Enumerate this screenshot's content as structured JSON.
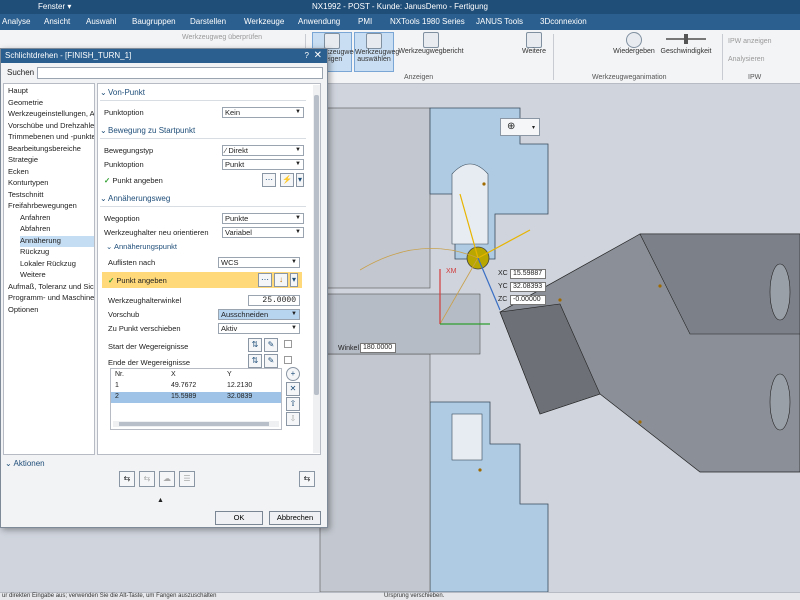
{
  "titlebar": {
    "title": "NX1992 - POST - Kunde: JanusDemo - Fertigung",
    "fenster": "Fenster ▾"
  },
  "menu": [
    "Analyse",
    "Ansicht",
    "Auswahl",
    "Baugruppen",
    "Darstellen",
    "Werkzeuge",
    "Anwendung",
    "PMI",
    "NXTools 1980 Series",
    "JANUS Tools",
    "3Dconnexion"
  ],
  "ribbon": {
    "werkzeugweg_pruefen": "Werkzeugweg überprüfen",
    "btn_werkzeugweg_zeigen": "Werkzeugweg zeigen",
    "btn_werkzeugweg_auswaehlen": "Werkzeugweg auswählen",
    "btn_werkzeugwegbericht": "Werkzeugwegbericht",
    "btn_weitere": "Weitere",
    "btn_wiedergeben": "Wiedergeben",
    "geschwindigkeit": "Geschwindigkeit",
    "ipw_anzeigen": "IPW anzeigen",
    "analysieren": "Analysieren",
    "group_anzeigen": "Anzeigen",
    "group_animation": "Werkzeugweganimation",
    "group_ipw": "IPW"
  },
  "dialog": {
    "title": "Schlichtdrehen - [FINISH_TURN_1]",
    "help": "?",
    "close": "✕",
    "search_label": "Suchen",
    "search_value": "",
    "tree": [
      {
        "label": "Haupt",
        "indent": 0,
        "sel": false
      },
      {
        "label": "Geometrie",
        "indent": 0,
        "sel": false
      },
      {
        "label": "Werkzeugeinstellungen, Ac",
        "indent": 0,
        "sel": false
      },
      {
        "label": "Vorschübe und Drehzahlen",
        "indent": 0,
        "sel": false
      },
      {
        "label": "Trimmebenen und -punkte",
        "indent": 0,
        "sel": false
      },
      {
        "label": "Bearbeitungsbereiche",
        "indent": 0,
        "sel": false
      },
      {
        "label": "Strategie",
        "indent": 0,
        "sel": false
      },
      {
        "label": "Ecken",
        "indent": 0,
        "sel": false
      },
      {
        "label": "Konturtypen",
        "indent": 0,
        "sel": false
      },
      {
        "label": "Testschnitt",
        "indent": 0,
        "sel": false
      },
      {
        "label": "Freifahrbewegungen",
        "indent": 0,
        "sel": false
      },
      {
        "label": "Anfahren",
        "indent": 1,
        "sel": false
      },
      {
        "label": "Abfahren",
        "indent": 1,
        "sel": false
      },
      {
        "label": "Annäherung",
        "indent": 1,
        "sel": true
      },
      {
        "label": "Rückzug",
        "indent": 1,
        "sel": false
      },
      {
        "label": "Lokaler Rückzug",
        "indent": 1,
        "sel": false
      },
      {
        "label": "Weitere",
        "indent": 1,
        "sel": false
      },
      {
        "label": "Aufmaß, Toleranz und Sich",
        "indent": 0,
        "sel": false
      },
      {
        "label": "Programm- und Maschine",
        "indent": 0,
        "sel": false
      },
      {
        "label": "Optionen",
        "indent": 0,
        "sel": false
      }
    ],
    "von_punkt": {
      "header": "Von-Punkt",
      "punktoption_label": "Punktoption",
      "punktoption_value": "Kein"
    },
    "bewegung": {
      "header": "Bewegung zu Startpunkt",
      "bewegungstyp_label": "Bewegungstyp",
      "bewegungstyp_value": "Direkt",
      "punktoption_label": "Punktoption",
      "punktoption_value": "Punkt",
      "punkt_angeben_label": "Punkt angeben"
    },
    "annaeherungsweg": {
      "header": "Annäherungsweg",
      "wegoption_label": "Wegoption",
      "wegoption_value": "Punkte",
      "wzh_label": "Werkzeughalter neu orientieren",
      "wzh_value": "Variabel",
      "sub_header": "Annäherungspunkt",
      "auflisten_label": "Auflisten nach",
      "auflisten_value": "WCS",
      "punkt_angeben_label": "Punkt angeben",
      "winkel_label": "Werkzeughalterwinkel",
      "winkel_value": "25.0000",
      "vorschub_label": "Vorschub",
      "vorschub_value": "Ausschneiden",
      "zu_punkt_label": "Zu Punkt verschieben",
      "zu_punkt_value": "Aktiv",
      "start_label": "Start der Wegereignisse",
      "ende_label": "Ende der Wegereignisse"
    },
    "table": {
      "headers": [
        "Nr.",
        "X",
        "Y"
      ],
      "rows": [
        {
          "nr": "1",
          "x": "49.7672",
          "y": "12.2130",
          "sel": false
        },
        {
          "nr": "2",
          "x": "15.5989",
          "y": "32.0839",
          "sel": true
        }
      ]
    },
    "aktionen": "Aktionen",
    "ok": "OK",
    "abbrechen": "Abbrechen"
  },
  "viewport": {
    "coords": {
      "xc_label": "XC",
      "xc_value": "15.59887",
      "yc_label": "YC",
      "yc_value": "32.08393",
      "zc_label": "ZC",
      "zc_value": "-0.00000"
    },
    "winkel_label": "Winkel",
    "winkel_value": "180.0000",
    "xm_label": "XM"
  },
  "statusbar": {
    "left": "ur direkten Eingabe aus; verwenden Sie die Alt-Taste, um Fangen auszuschalten",
    "right": "Ursprung verschieben."
  },
  "colors": {
    "titlebar": "#1f4e79",
    "accent": "#2b5f8f",
    "highlight": "#ffd97a",
    "selection": "#c5ddf3",
    "part": "#aecbe3",
    "tool": "#6d7177"
  }
}
